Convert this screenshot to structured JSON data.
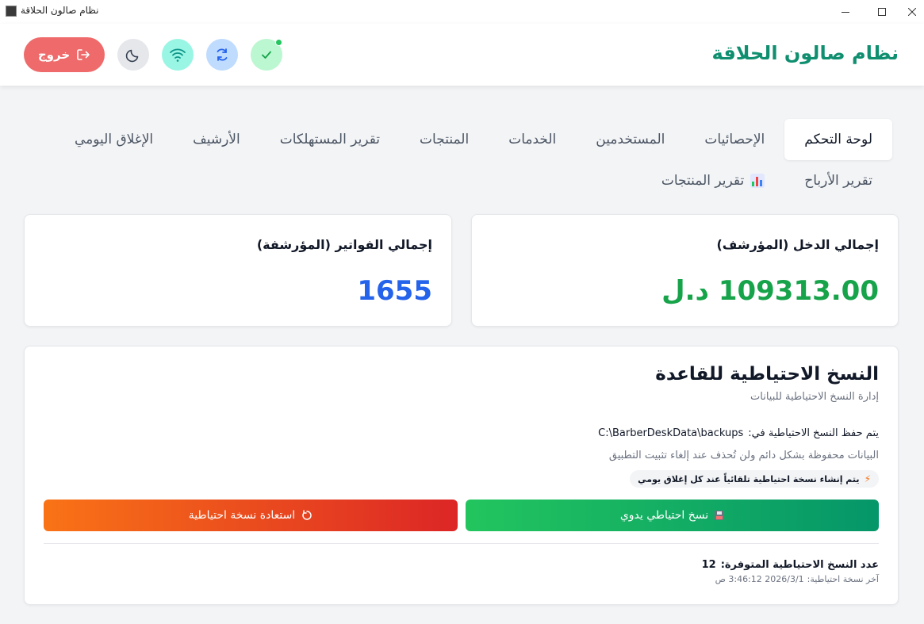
{
  "window": {
    "title": "نظام صالون الحلاقة"
  },
  "header": {
    "app_title": "نظام صالون الحلاقة",
    "logout_label": "خروج",
    "icons": [
      "check-icon",
      "sync-icon",
      "wifi-icon",
      "moon-icon",
      "logout-icon"
    ]
  },
  "tabs": {
    "row1": [
      "لوحة التحكم",
      "الإحصائيات",
      "المستخدمين",
      "الخدمات",
      "المنتجات",
      "تقرير المستهلكات",
      "الأرشيف",
      "الإغلاق اليومي"
    ],
    "row2": [
      "تقرير الأرباح",
      "تقرير المنتجات"
    ],
    "active": "لوحة التحكم"
  },
  "stats": {
    "income_label": "إجمالي الدخل (المؤرشف)",
    "income_value": "109313.00 د.ل",
    "invoices_label": "إجمالي الفواتير (المؤرشفة)",
    "invoices_value": "1655"
  },
  "backup": {
    "title": "النسخ الاحتياطية للقاعدة",
    "subtitle": "إدارة النسخ الاحتياطية للبيانات",
    "path_label": "يتم حفظ النسخ الاحتياطية في:",
    "path_value": "C:\\BarberDeskData\\backups",
    "note": "البيانات محفوظة بشكل دائم ولن تُحذف عند إلغاء تثبيت التطبيق",
    "auto_note": "يتم إنشاء نسخة احتياطية تلقائياً عند كل إغلاق يومي",
    "manual_button": "نسخ احتياطي يدوي",
    "restore_button": "استعادة نسخة احتياطية",
    "count_label": "عدد النسخ الاحتياطية المتوفرة:",
    "count_value": "12",
    "last_label": "آخر نسخة احتياطية:",
    "last_value": "2026/3/1 3:46:12 ص"
  },
  "colors": {
    "brand": "#0f8f6f",
    "income": "#16a34a",
    "invoices": "#2563eb",
    "logout": "#ef6a6a"
  }
}
